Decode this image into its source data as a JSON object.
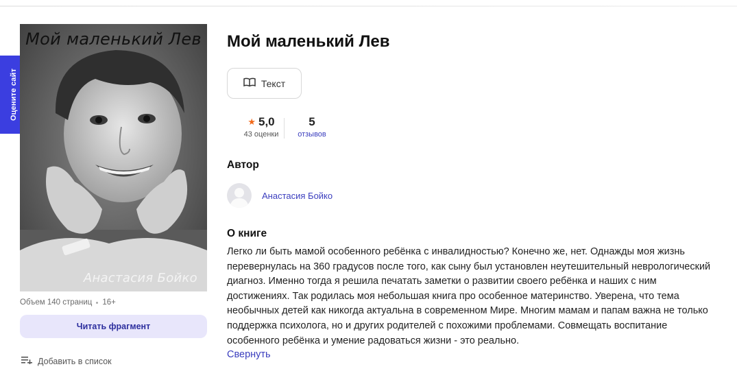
{
  "rate_tab": {
    "label": "Оцените сайт"
  },
  "book": {
    "cover_title": "Мой маленький Лев",
    "cover_author": "Анастасия Бойко",
    "title": "Мой маленький Лев",
    "meta": {
      "volume": "Объем 140 страниц",
      "age": "16+"
    },
    "format_button": "Текст",
    "rating": {
      "value": "5,0",
      "count_label": "43 оценки"
    },
    "reviews": {
      "value": "5",
      "label": "отзывов"
    }
  },
  "actions": {
    "read_fragment": "Читать фрагмент",
    "add_to_list": "Добавить в список"
  },
  "author_section": {
    "heading": "Автор",
    "name": "Анастасия Бойко"
  },
  "about_section": {
    "heading": "О книге",
    "description": "Легко ли быть мамой особенного ребёнка с инвалидностью? Конечно же, нет. Однажды моя жизнь перевернулась на 360 градусов после того, как сыну был установлен неутешительный неврологический диагноз. Именно тогда я решила печатать заметки о развитии своего ребёнка и наших с ним достижениях. Так родилась моя небольшая книга про особенное материнство. Уверена, что тема необычных детей как никогда актуальна в современном Мире. Многим мамам и папам важна не только поддержка психолога, но и других родителей с похожими проблемами. Совмещать воспитание особенного ребёнка и умение радоваться жизни - это реально.",
    "collapse_link": "Свернуть"
  },
  "colors": {
    "accent": "#3b3ee0",
    "link": "#3b3ebe",
    "star": "#f26a1b",
    "button_bg": "#e8e6fb"
  },
  "icons": {
    "format": "book-open-icon",
    "star": "star-icon",
    "add_list": "list-add-icon",
    "avatar": "user-avatar-icon"
  }
}
